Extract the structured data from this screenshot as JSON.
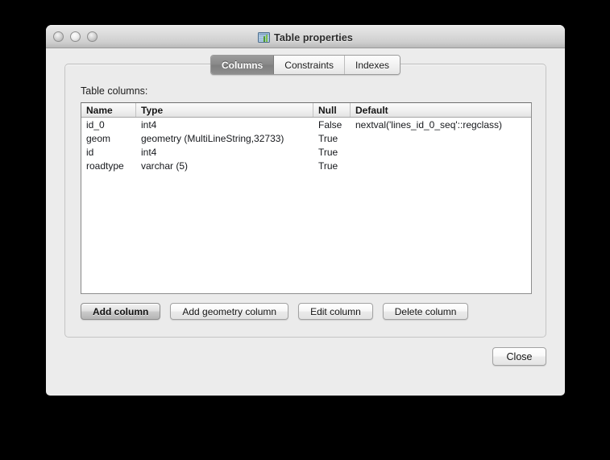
{
  "window": {
    "title": "Table properties",
    "title_icon": "table-properties-icon",
    "controls": [
      {
        "name": "close-window-button"
      },
      {
        "name": "minimize-window-button"
      },
      {
        "name": "zoom-window-button"
      }
    ]
  },
  "tabs": [
    {
      "label": "Columns",
      "selected": true
    },
    {
      "label": "Constraints",
      "selected": false
    },
    {
      "label": "Indexes",
      "selected": false
    }
  ],
  "panel": {
    "label": "Table columns:"
  },
  "table": {
    "headers": [
      "Name",
      "Type",
      "Null",
      "Default"
    ],
    "rows": [
      {
        "name": "id_0",
        "type": "int4",
        "null": "False",
        "default": "nextval('lines_id_0_seq'::regclass)"
      },
      {
        "name": "geom",
        "type": "geometry (MultiLineString,32733)",
        "null": "True",
        "default": ""
      },
      {
        "name": "id",
        "type": "int4",
        "null": "True",
        "default": ""
      },
      {
        "name": "roadtype",
        "type": "varchar (5)",
        "null": "True",
        "default": ""
      }
    ]
  },
  "buttons": {
    "add_column": "Add column",
    "add_geometry_column": "Add geometry column",
    "edit_column": "Edit column",
    "delete_column": "Delete column",
    "close": "Close"
  },
  "colors": {
    "window_background": "#ececec",
    "panel_background": "#ebebeb",
    "list_background": "#ffffff",
    "selected_tab": "#8a8a8a",
    "desktop": "#000000"
  }
}
